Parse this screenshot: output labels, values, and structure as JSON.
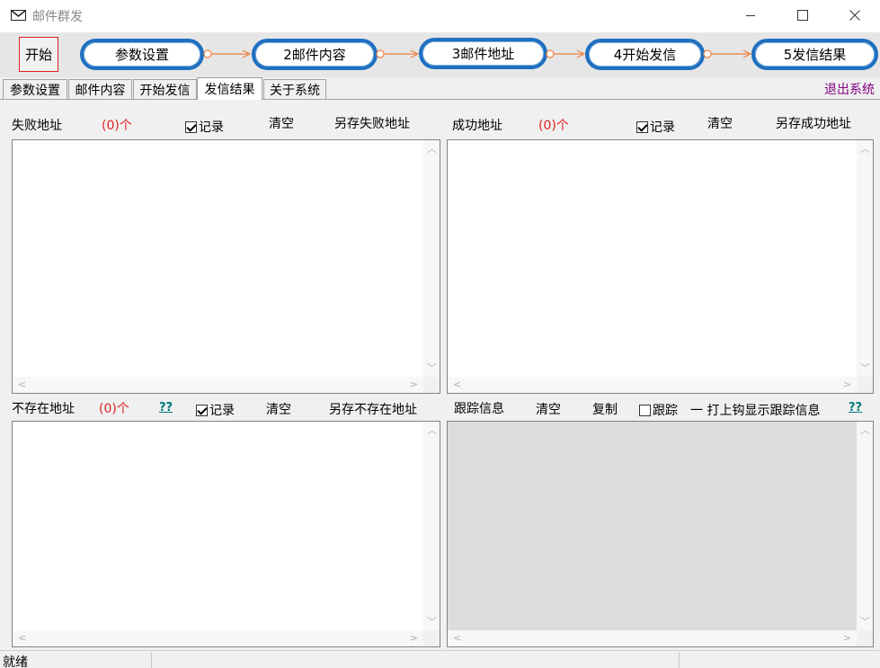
{
  "window": {
    "title": "邮件群发"
  },
  "flow": {
    "start_label": "开始",
    "steps": [
      "参数设置",
      "2邮件内容",
      "3邮件地址",
      "4开始发信",
      "5发信结果"
    ]
  },
  "tabs": [
    "参数设置",
    "邮件内容",
    "开始发信",
    "发信结果",
    "关于系统"
  ],
  "exit_label": "退出系统",
  "failed": {
    "label": "失败地址",
    "count": "(0)个",
    "record": "记录",
    "clear": "清空",
    "save": "另存失败地址"
  },
  "success": {
    "label": "成功地址",
    "count": "(0)个",
    "record": "记录",
    "clear": "清空",
    "save": "另存成功地址"
  },
  "notexist": {
    "label": "不存在地址",
    "count": "(0)个",
    "help": "??",
    "record": "记录",
    "clear": "清空",
    "save": "另存不存在地址"
  },
  "trace": {
    "label": "跟踪信息",
    "clear": "清空",
    "copy": "复制",
    "track": "跟踪",
    "hint": "一 打上钩显示跟踪信息",
    "help": "??"
  },
  "status": {
    "text": "就绪"
  },
  "colors": {
    "accent_border": "#1f6fc0",
    "start_border": "#e02020",
    "count_red": "#e02020",
    "exit_purple": "#800080",
    "help_teal": "#007b7b",
    "arrow_orange": "#f08040"
  }
}
